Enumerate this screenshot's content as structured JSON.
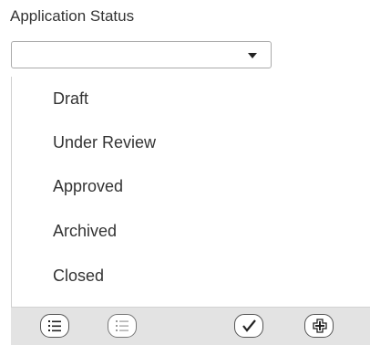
{
  "field": {
    "label": "Application Status",
    "selected_value": ""
  },
  "dropdown": {
    "options": [
      "Draft",
      "Under Review",
      "Approved",
      "Archived",
      "Closed"
    ]
  },
  "toolbar": {
    "buttons": [
      {
        "icon": "select-all-icon"
      },
      {
        "icon": "deselect-all-icon"
      },
      {
        "icon": "checkmark-icon"
      },
      {
        "icon": "add-icon"
      }
    ]
  }
}
